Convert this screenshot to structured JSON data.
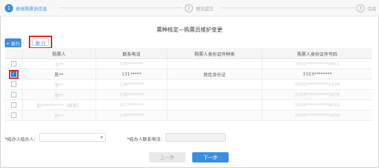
{
  "stepper": {
    "steps": [
      {
        "num": "1",
        "label": "修改购票员信息"
      },
      {
        "num": "2",
        "label": "预览提交"
      },
      {
        "num": "3",
        "label": "完成"
      }
    ]
  },
  "page_title": "票种核定—购票员维护变更",
  "toolbar": {
    "add_label": "+ 新行",
    "delete_label": "删 行"
  },
  "table": {
    "columns": [
      "购票人",
      "联系电话",
      "购票人身份证件种类",
      "购票人身份证件号码"
    ],
    "rows": [
      {
        "checked": false,
        "name": "王**",
        "phone": "135*******",
        "id_type": "",
        "id_number": "3301**********0011"
      },
      {
        "checked": true,
        "name": "陈**",
        "phone": "131*****",
        "id_type": "居民身份证",
        "id_number": "3323********"
      },
      {
        "checked": false,
        "name": "李**",
        "phone": "138*******",
        "id_type": "",
        "id_number": "3302**********1234"
      },
      {
        "checked": false,
        "name": "张**",
        "phone": "139*******",
        "id_type": "",
        "id_number": "3303**********5678"
      },
      {
        "checked": false,
        "name": "赵**********（财务）",
        "phone": "137*******",
        "id_type": "",
        "id_number": "3304**********9012"
      },
      {
        "checked": false,
        "name": "孙**",
        "phone": "136*******",
        "id_type": "",
        "id_number": "3305**********3456"
      }
    ]
  },
  "form": {
    "operator_label": "*经办人经办人：",
    "operator_value": "",
    "phone_label": "*经办人联系电话：",
    "phone_value": ""
  },
  "buttons": {
    "prev": "上一步",
    "next": "下一步"
  }
}
